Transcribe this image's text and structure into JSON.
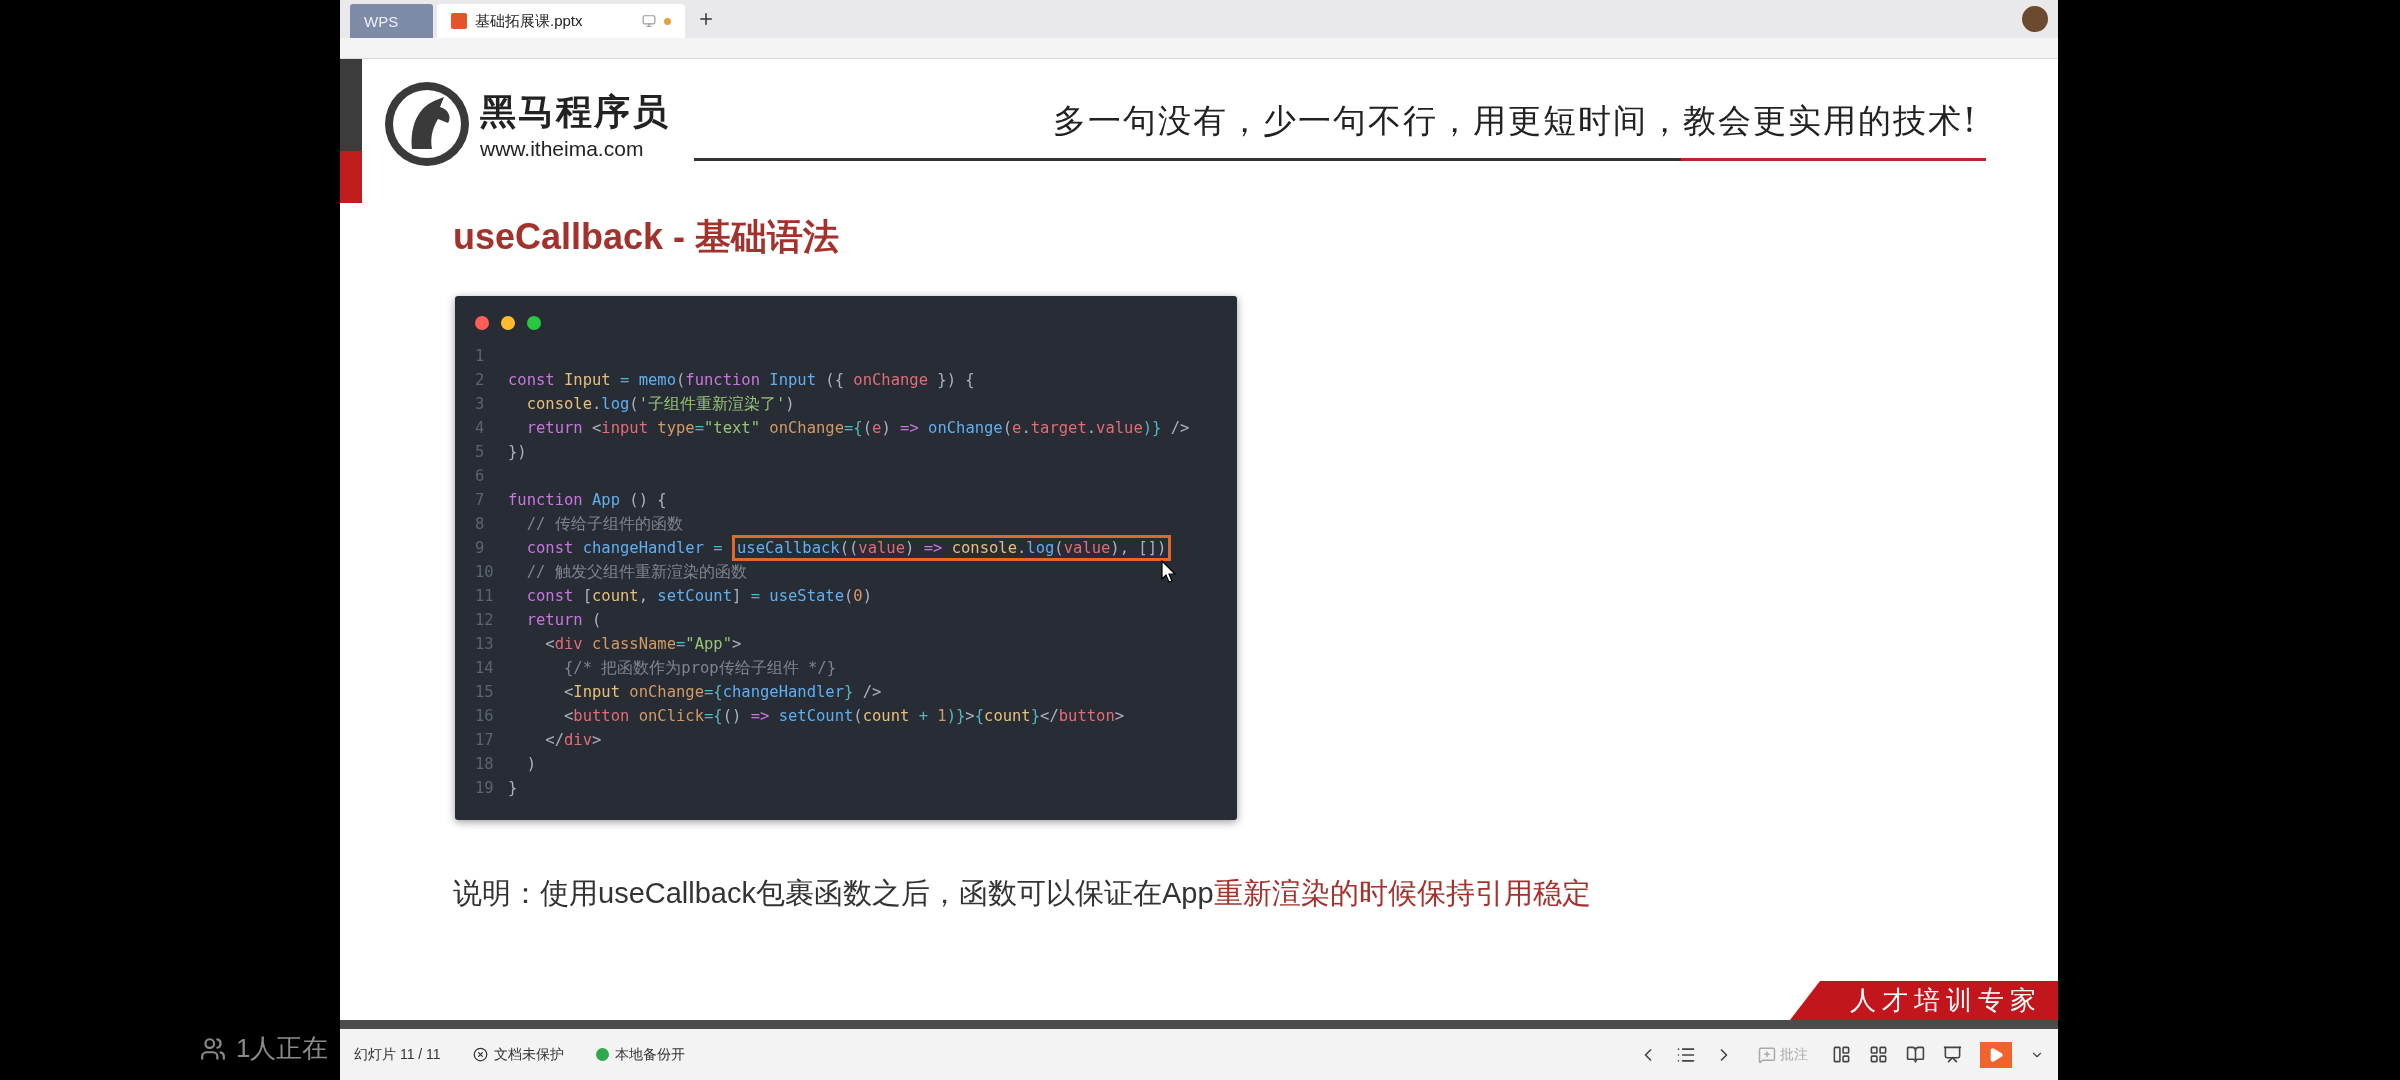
{
  "overlay": {
    "viewers": "1人正在"
  },
  "tabs": [
    {
      "kind": "home",
      "label": "WPS",
      "selected": false,
      "modified": false
    },
    {
      "kind": "document",
      "label": "基础拓展课.pptx",
      "selected": true,
      "modified": true
    }
  ],
  "slide": {
    "brand": {
      "name": "黑马程序员",
      "url": "www.itheima.com"
    },
    "slogan": "多一句没有，少一句不行，用更短时间，教会更实用的技术!",
    "title": "useCallback - 基础语法",
    "code": {
      "lines": [
        {
          "number": "1"
        },
        {
          "number": "2",
          "tokens": [
            {
              "text": "const",
              "kind": "kw"
            },
            {
              "text": " Input",
              "kind": "cls"
            },
            {
              "text": " =",
              "kind": "op"
            },
            {
              "text": " memo",
              "kind": "fn"
            },
            {
              "text": "(",
              "kind": "p"
            },
            {
              "text": "function",
              "kind": "kw"
            },
            {
              "text": " Input",
              "kind": "fn"
            },
            {
              "text": " ({ ",
              "kind": "p"
            },
            {
              "text": "onChange",
              "kind": "param"
            },
            {
              "text": " }) {",
              "kind": "p"
            }
          ]
        },
        {
          "number": "3",
          "tokens": [
            {
              "text": "  console",
              "kind": "cls"
            },
            {
              "text": ".",
              "kind": "p"
            },
            {
              "text": "log",
              "kind": "fn"
            },
            {
              "text": "(",
              "kind": "p"
            },
            {
              "text": "'子组件重新渲染了'",
              "kind": "str"
            },
            {
              "text": ")",
              "kind": "p"
            }
          ]
        },
        {
          "number": "4",
          "tokens": [
            {
              "text": "  return",
              "kind": "kw"
            },
            {
              "text": " <",
              "kind": "p"
            },
            {
              "text": "input",
              "kind": "tag"
            },
            {
              "text": " type",
              "kind": "attr"
            },
            {
              "text": "=",
              "kind": "op"
            },
            {
              "text": "\"text\"",
              "kind": "str"
            },
            {
              "text": " onChange",
              "kind": "attr"
            },
            {
              "text": "={",
              "kind": "op"
            },
            {
              "text": "(",
              "kind": "p"
            },
            {
              "text": "e",
              "kind": "param"
            },
            {
              "text": ")",
              "kind": "p"
            },
            {
              "text": " =>",
              "kind": "kw"
            },
            {
              "text": " onChange",
              "kind": "fn"
            },
            {
              "text": "(",
              "kind": "p"
            },
            {
              "text": "e",
              "kind": "param"
            },
            {
              "text": ".",
              "kind": "p"
            },
            {
              "text": "target",
              "kind": "param"
            },
            {
              "text": ".",
              "kind": "p"
            },
            {
              "text": "value",
              "kind": "param"
            },
            {
              "text": ")}",
              "kind": "op"
            },
            {
              "text": " />",
              "kind": "p"
            }
          ]
        },
        {
          "number": "5",
          "tokens": [
            {
              "text": "})",
              "kind": "p"
            }
          ]
        },
        {
          "number": "6"
        },
        {
          "number": "7",
          "tokens": [
            {
              "text": "function",
              "kind": "kw"
            },
            {
              "text": " App",
              "kind": "fn"
            },
            {
              "text": " () {",
              "kind": "p"
            }
          ]
        },
        {
          "number": "8",
          "tokens": [
            {
              "text": "  // 传给子组件的函数",
              "kind": "comment"
            }
          ]
        },
        {
          "number": "9",
          "tokens": [
            {
              "text": "  const",
              "kind": "kw"
            },
            {
              "text": " changeHandler",
              "kind": "fn"
            },
            {
              "text": " = ",
              "kind": "op"
            }
          ],
          "highlighted": [
            {
              "text": "useCallback",
              "kind": "fn"
            },
            {
              "text": "((",
              "kind": "p"
            },
            {
              "text": "value",
              "kind": "param"
            },
            {
              "text": ")",
              "kind": "p"
            },
            {
              "text": " =>",
              "kind": "kw"
            },
            {
              "text": " console",
              "kind": "cls"
            },
            {
              "text": ".",
              "kind": "p"
            },
            {
              "text": "log",
              "kind": "fn"
            },
            {
              "text": "(",
              "kind": "p"
            },
            {
              "text": "value",
              "kind": "param"
            },
            {
              "text": "), ",
              "kind": "p"
            },
            {
              "text": "[]",
              "kind": "p"
            },
            {
              "text": ")",
              "kind": "p"
            }
          ]
        },
        {
          "number": "10",
          "tokens": [
            {
              "text": "  // 触发父组件重新渲染的函数",
              "kind": "comment"
            }
          ]
        },
        {
          "number": "11",
          "tokens": [
            {
              "text": "  const",
              "kind": "kw"
            },
            {
              "text": " [",
              "kind": "p"
            },
            {
              "text": "count",
              "kind": "cls"
            },
            {
              "text": ", ",
              "kind": "p"
            },
            {
              "text": "setCount",
              "kind": "fn"
            },
            {
              "text": "]",
              "kind": "p"
            },
            {
              "text": " =",
              "kind": "op"
            },
            {
              "text": " useState",
              "kind": "fn"
            },
            {
              "text": "(",
              "kind": "p"
            },
            {
              "text": "0",
              "kind": "num"
            },
            {
              "text": ")",
              "kind": "p"
            }
          ]
        },
        {
          "number": "12",
          "tokens": [
            {
              "text": "  return",
              "kind": "kw"
            },
            {
              "text": " (",
              "kind": "p"
            }
          ]
        },
        {
          "number": "13",
          "tokens": [
            {
              "text": "    <",
              "kind": "p"
            },
            {
              "text": "div",
              "kind": "tag"
            },
            {
              "text": " className",
              "kind": "attr"
            },
            {
              "text": "=",
              "kind": "op"
            },
            {
              "text": "\"App\"",
              "kind": "str"
            },
            {
              "text": ">",
              "kind": "p"
            }
          ]
        },
        {
          "number": "14",
          "tokens": [
            {
              "text": "      {/* 把函数作为prop传给子组件 */}",
              "kind": "comment"
            }
          ]
        },
        {
          "number": "15",
          "tokens": [
            {
              "text": "      <",
              "kind": "p"
            },
            {
              "text": "Input",
              "kind": "cls"
            },
            {
              "text": " onChange",
              "kind": "attr"
            },
            {
              "text": "={",
              "kind": "op"
            },
            {
              "text": "changeHandler",
              "kind": "fn"
            },
            {
              "text": "}",
              "kind": "op"
            },
            {
              "text": " />",
              "kind": "p"
            }
          ]
        },
        {
          "number": "16",
          "tokens": [
            {
              "text": "      <",
              "kind": "p"
            },
            {
              "text": "button",
              "kind": "tag"
            },
            {
              "text": " onClick",
              "kind": "attr"
            },
            {
              "text": "={",
              "kind": "op"
            },
            {
              "text": "()",
              "kind": "p"
            },
            {
              "text": " =>",
              "kind": "kw"
            },
            {
              "text": " setCount",
              "kind": "fn"
            },
            {
              "text": "(",
              "kind": "p"
            },
            {
              "text": "count",
              "kind": "cls"
            },
            {
              "text": " + ",
              "kind": "op"
            },
            {
              "text": "1",
              "kind": "num"
            },
            {
              "text": ")}",
              "kind": "op"
            },
            {
              "text": ">",
              "kind": "p"
            },
            {
              "text": "{",
              "kind": "op"
            },
            {
              "text": "count",
              "kind": "cls"
            },
            {
              "text": "}",
              "kind": "op"
            },
            {
              "text": "</",
              "kind": "p"
            },
            {
              "text": "button",
              "kind": "tag"
            },
            {
              "text": ">",
              "kind": "p"
            }
          ]
        },
        {
          "number": "17",
          "tokens": [
            {
              "text": "    </",
              "kind": "p"
            },
            {
              "text": "div",
              "kind": "tag"
            },
            {
              "text": ">",
              "kind": "p"
            }
          ]
        },
        {
          "number": "18",
          "tokens": [
            {
              "text": "  )",
              "kind": "p"
            }
          ]
        },
        {
          "number": "19",
          "tokens": [
            {
              "text": "}",
              "kind": "p"
            }
          ]
        }
      ]
    },
    "note": {
      "text": "说明：使用useCallback包裹函数之后，函数可以保证在App",
      "emphasis": "重新渲染的时候保持引用稳定"
    },
    "banner": "人才培训专家"
  },
  "status_bar": {
    "slide_counter": "幻灯片 11 / 11",
    "protection": "文档未保护",
    "backup": "本地备份开",
    "comment": "批注"
  }
}
